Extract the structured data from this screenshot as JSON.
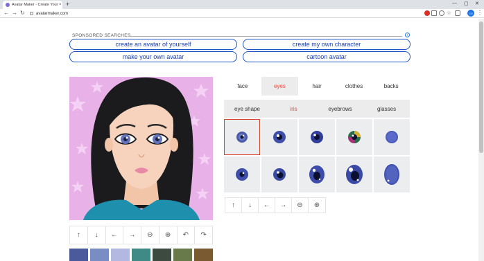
{
  "browser": {
    "tab_title": "Avatar Maker - Create Your Own",
    "tab_close": "×",
    "new_tab": "+",
    "url": "avatarmaker.com",
    "profile_initials": "CS",
    "window_controls": [
      "—",
      "▢",
      "✕"
    ]
  },
  "sponsored": {
    "title": "SPONSORED SEARCHES",
    "info": "i",
    "links": [
      "create an avatar of yourself",
      "create my own character",
      "make your own avatar",
      "cartoon avatar"
    ]
  },
  "categories": {
    "tabs": [
      "face",
      "eyes",
      "hair",
      "clothes",
      "backs"
    ],
    "active": "eyes"
  },
  "subcategories": {
    "tabs": [
      "eye shape",
      "iris",
      "eyebrows",
      "glasses"
    ],
    "active": "iris"
  },
  "preview_controls": {
    "icons": [
      "arrow-up-icon",
      "arrow-down-icon",
      "arrow-left-icon",
      "arrow-right-icon",
      "zoom-out-icon",
      "zoom-in-icon",
      "undo-icon",
      "redo-icon"
    ]
  },
  "grid_controls": {
    "icons": [
      "arrow-up-icon",
      "arrow-down-icon",
      "arrow-left-icon",
      "arrow-right-icon",
      "zoom-out-icon",
      "zoom-in-icon"
    ]
  },
  "colors": {
    "accent_red": "#e34b3d",
    "link_blue": "#1a53c8",
    "background_pink": "#e8b2e8",
    "swatches": [
      "#4a5a9c",
      "#7a8cc4",
      "#b3b8e0",
      "#3f8a86",
      "#3c4a3f",
      "#697a4a",
      "#7a5a30"
    ]
  }
}
